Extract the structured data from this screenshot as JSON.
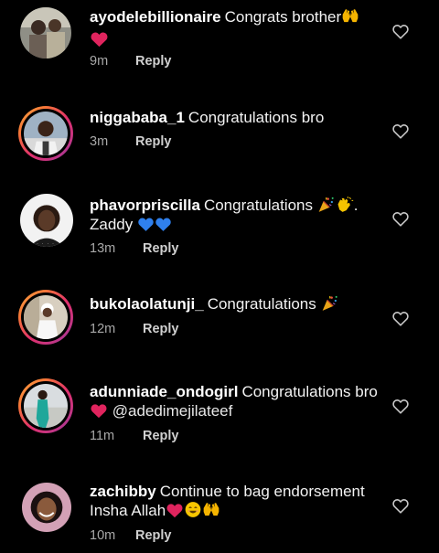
{
  "comments": [
    {
      "username": "ayodelebillionaire",
      "text": "Congrats brother",
      "emojis_end": [
        "raising-hands",
        "red-heart"
      ],
      "time": "9m",
      "reply": "Reply"
    },
    {
      "username": "niggababa_1",
      "text": "Congratulations bro",
      "time": "3m",
      "reply": "Reply"
    },
    {
      "username": "phavorpriscilla",
      "text": "Congratulations",
      "emojis_mid": [
        "party-popper",
        "clapping-hand"
      ],
      "text2": ". Zaddy",
      "emojis_end": [
        "blue-heart",
        "blue-heart"
      ],
      "time": "13m",
      "reply": "Reply",
      "avatar_caption": "· · · ·"
    },
    {
      "username": "bukolaolatunji_",
      "text": "Congratulations",
      "emojis_end": [
        "party-popper"
      ],
      "time": "12m",
      "reply": "Reply"
    },
    {
      "username": "adunniade_ondogirl",
      "text": "Congratulations bro",
      "emojis_mid": [
        "red-heart"
      ],
      "mention": "@adedimejilateef",
      "time": "11m",
      "reply": "Reply"
    },
    {
      "username": "zachibby",
      "text": "Continue to bag endorsement Insha Allah",
      "emojis_end": [
        "red-heart",
        "smiling-face",
        "raising-hands"
      ],
      "time": "10m",
      "reply": "Reply"
    }
  ],
  "colors": {
    "background": "#000000",
    "text": "#f2f2f2",
    "muted": "#a8a8a8",
    "heart_red": "#e0245e",
    "blue_heart": "#2f80ed"
  }
}
